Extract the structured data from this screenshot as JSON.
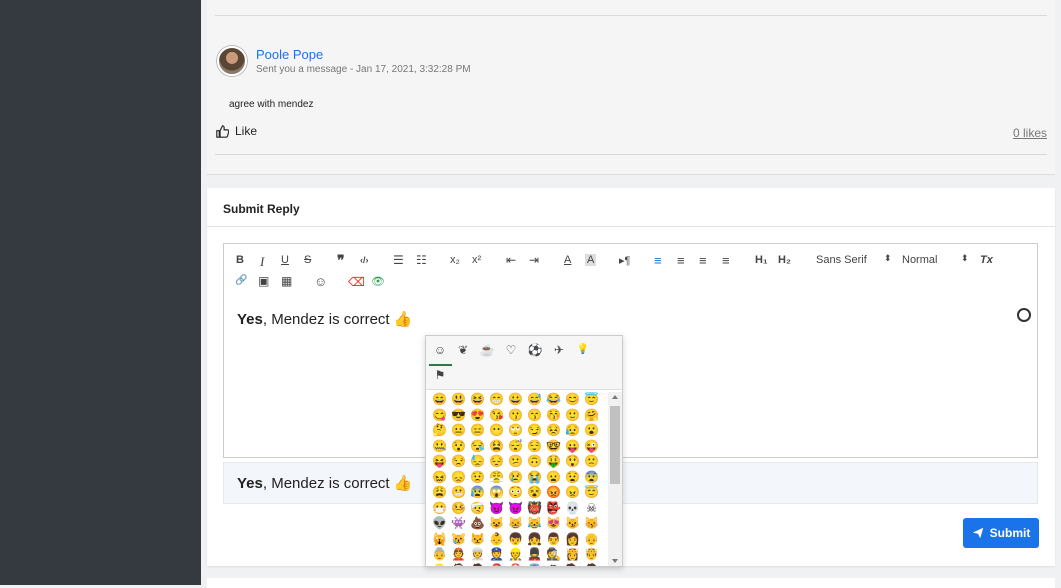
{
  "message": {
    "sender": "Poole Pope",
    "sent_info": "Sent you a message - Jan 17, 2021, 3:32:28 PM",
    "body": "agree with mendez",
    "like_label": "Like",
    "likes_count": "0 likes"
  },
  "reply": {
    "title": "Submit Reply",
    "editor_bold": "Yes",
    "editor_rest": ", Mendez is correct ",
    "preview_bold": "Yes",
    "preview_rest": ", Mendez is correct ",
    "emoji": "👍",
    "submit_label": "Submit"
  },
  "toolbar": {
    "bold": "B",
    "italic": "I",
    "underline": "U",
    "strike": "S",
    "blockquote": "❞",
    "code": "‹/›",
    "ordered_list": "☰",
    "bullet_list": "☷",
    "subscript": "x₂",
    "superscript": "x²",
    "outdent": "⇤",
    "indent": "⇥",
    "font_color": "A",
    "bg_color": "A",
    "direction": "▸¶",
    "align_left": "≡",
    "align_center": "≡",
    "align_right": "≡",
    "align_justify": "≡",
    "h1": "H₁",
    "h2": "H₂",
    "font_family": "Sans Serif",
    "font_size": "Normal",
    "clear_format": "Tx",
    "link": "🔗",
    "image": "▣",
    "video": "▦",
    "emoji": "☺",
    "eraser": "⌫",
    "preview": "👁"
  },
  "colors": {
    "accent": "#1a73e8",
    "sidebar": "#343a40",
    "eraser": "#d93025",
    "preview_eye": "#2e9e4f"
  },
  "emoji_tabs": [
    "☺",
    "❦",
    "☕",
    "♡",
    "⚽",
    "✈",
    "💡",
    "⚑"
  ],
  "emojis": [
    "😄",
    "😃",
    "😆",
    "😁",
    "😀",
    "😅",
    "😂",
    "😊",
    "😇",
    "😋",
    "😎",
    "😍",
    "😘",
    "😗",
    "😙",
    "😚",
    "🙂",
    "🤗",
    "🤔",
    "😐",
    "😑",
    "😶",
    "🙄",
    "😏",
    "😣",
    "😥",
    "😮",
    "🤐",
    "😯",
    "😪",
    "😫",
    "😴",
    "😌",
    "🤓",
    "😛",
    "😜",
    "😝",
    "😒",
    "😓",
    "😔",
    "😕",
    "🙃",
    "🤑",
    "😲",
    "🙁",
    "😖",
    "😞",
    "😟",
    "😤",
    "😢",
    "😭",
    "😦",
    "😧",
    "😨",
    "😩",
    "😬",
    "😰",
    "😱",
    "😳",
    "😵",
    "😡",
    "😠",
    "😇",
    "😷",
    "🤒",
    "🤕",
    "😈",
    "👿",
    "👹",
    "👺",
    "💀",
    "☠",
    "👽",
    "👾",
    "💩",
    "😺",
    "😸",
    "😹",
    "😻",
    "😼",
    "😽",
    "🙀",
    "😿",
    "😾",
    "👶",
    "👦",
    "👧",
    "👨",
    "👩",
    "👴",
    "👵",
    "👲",
    "👳",
    "👮",
    "👷",
    "💂",
    "🕵",
    "👸",
    "🤴",
    "👱",
    "👰",
    "🤵",
    "🎅",
    "🤶",
    "👼",
    "🙇",
    "💁",
    "🙅"
  ]
}
